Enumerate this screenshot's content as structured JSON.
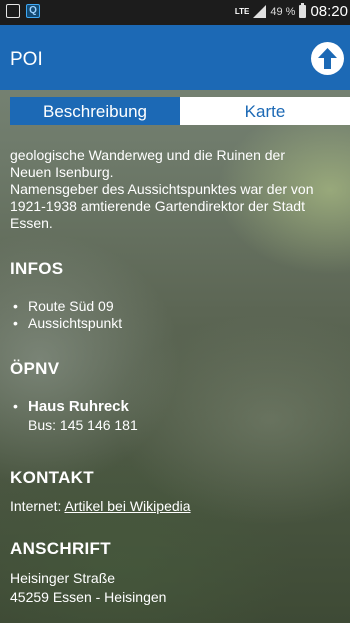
{
  "status_bar": {
    "network": "LTE",
    "battery_percent": "49 %",
    "time": "08:20"
  },
  "app_bar": {
    "title": "POI",
    "up_icon": "arrow-up-circle-icon"
  },
  "tabs": [
    {
      "label": "Beschreibung",
      "active": true
    },
    {
      "label": "Karte",
      "active": false
    }
  ],
  "description": {
    "text_line_1": "geologische Wanderweg und die Ruinen der",
    "text_line_2": "Neuen Isenburg.",
    "text_line_3": "Namensgeber des Aussichtspunktes war der von",
    "text_line_4": "1921-1938 amtierende Gartendirektor der Stadt",
    "text_line_5": "Essen."
  },
  "infos": {
    "heading": "INFOS",
    "items": [
      "Route Süd 09",
      "Aussichtspunkt"
    ]
  },
  "oepnv": {
    "heading": "ÖPNV",
    "stop_name": "Haus Ruhreck",
    "bus_lines": "Bus: 145 146 181"
  },
  "kontakt": {
    "heading": "KONTAKT",
    "internet_label": "Internet: ",
    "link_text": "Artikel bei Wikipedia"
  },
  "anschrift": {
    "heading": "ANSCHRIFT",
    "street": "Heisinger Straße",
    "city": "45259 Essen - Heisingen"
  },
  "colors": {
    "brand_blue": "#1c69b5",
    "status_bar": "#1c1c1c"
  }
}
